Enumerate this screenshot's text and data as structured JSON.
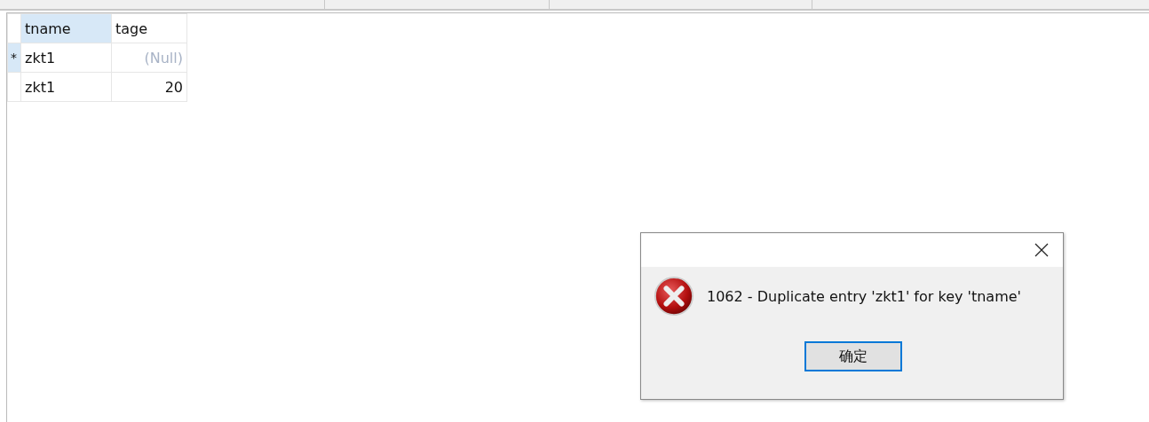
{
  "table": {
    "columns": [
      {
        "label": "tname",
        "kind": "text",
        "selected": true
      },
      {
        "label": "tage",
        "kind": "number",
        "selected": false
      }
    ],
    "rows": [
      {
        "marker": "*",
        "selected": true,
        "cells": [
          {
            "kind": "value",
            "text": "zkt1"
          },
          {
            "kind": "null",
            "text": "(Null)"
          }
        ]
      },
      {
        "selected": false,
        "cells": [
          {
            "kind": "value",
            "text": "zkt1"
          },
          {
            "kind": "value",
            "text": "20"
          }
        ]
      }
    ]
  },
  "dialog": {
    "message": "1062 - Duplicate entry 'zkt1' for key 'tname'",
    "buttons": [
      "确定"
    ]
  }
}
